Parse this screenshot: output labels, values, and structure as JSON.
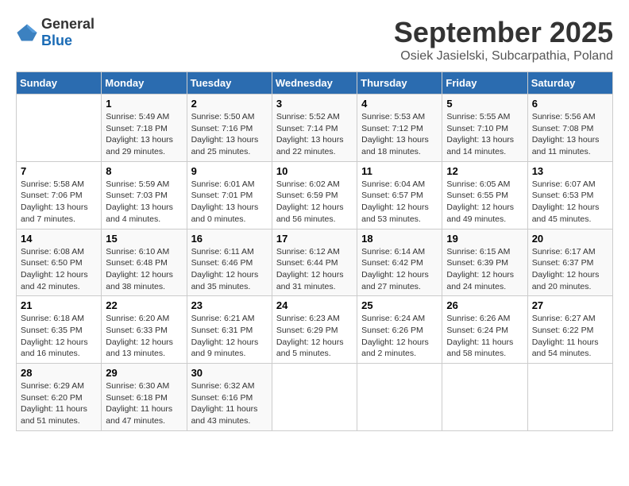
{
  "header": {
    "logo_general": "General",
    "logo_blue": "Blue",
    "month_title": "September 2025",
    "subtitle": "Osiek Jasielski, Subcarpathia, Poland"
  },
  "columns": [
    "Sunday",
    "Monday",
    "Tuesday",
    "Wednesday",
    "Thursday",
    "Friday",
    "Saturday"
  ],
  "weeks": [
    [
      {
        "day": "",
        "info": ""
      },
      {
        "day": "1",
        "info": "Sunrise: 5:49 AM\nSunset: 7:18 PM\nDaylight: 13 hours\nand 29 minutes."
      },
      {
        "day": "2",
        "info": "Sunrise: 5:50 AM\nSunset: 7:16 PM\nDaylight: 13 hours\nand 25 minutes."
      },
      {
        "day": "3",
        "info": "Sunrise: 5:52 AM\nSunset: 7:14 PM\nDaylight: 13 hours\nand 22 minutes."
      },
      {
        "day": "4",
        "info": "Sunrise: 5:53 AM\nSunset: 7:12 PM\nDaylight: 13 hours\nand 18 minutes."
      },
      {
        "day": "5",
        "info": "Sunrise: 5:55 AM\nSunset: 7:10 PM\nDaylight: 13 hours\nand 14 minutes."
      },
      {
        "day": "6",
        "info": "Sunrise: 5:56 AM\nSunset: 7:08 PM\nDaylight: 13 hours\nand 11 minutes."
      }
    ],
    [
      {
        "day": "7",
        "info": "Sunrise: 5:58 AM\nSunset: 7:06 PM\nDaylight: 13 hours\nand 7 minutes."
      },
      {
        "day": "8",
        "info": "Sunrise: 5:59 AM\nSunset: 7:03 PM\nDaylight: 13 hours\nand 4 minutes."
      },
      {
        "day": "9",
        "info": "Sunrise: 6:01 AM\nSunset: 7:01 PM\nDaylight: 13 hours\nand 0 minutes."
      },
      {
        "day": "10",
        "info": "Sunrise: 6:02 AM\nSunset: 6:59 PM\nDaylight: 12 hours\nand 56 minutes."
      },
      {
        "day": "11",
        "info": "Sunrise: 6:04 AM\nSunset: 6:57 PM\nDaylight: 12 hours\nand 53 minutes."
      },
      {
        "day": "12",
        "info": "Sunrise: 6:05 AM\nSunset: 6:55 PM\nDaylight: 12 hours\nand 49 minutes."
      },
      {
        "day": "13",
        "info": "Sunrise: 6:07 AM\nSunset: 6:53 PM\nDaylight: 12 hours\nand 45 minutes."
      }
    ],
    [
      {
        "day": "14",
        "info": "Sunrise: 6:08 AM\nSunset: 6:50 PM\nDaylight: 12 hours\nand 42 minutes."
      },
      {
        "day": "15",
        "info": "Sunrise: 6:10 AM\nSunset: 6:48 PM\nDaylight: 12 hours\nand 38 minutes."
      },
      {
        "day": "16",
        "info": "Sunrise: 6:11 AM\nSunset: 6:46 PM\nDaylight: 12 hours\nand 35 minutes."
      },
      {
        "day": "17",
        "info": "Sunrise: 6:12 AM\nSunset: 6:44 PM\nDaylight: 12 hours\nand 31 minutes."
      },
      {
        "day": "18",
        "info": "Sunrise: 6:14 AM\nSunset: 6:42 PM\nDaylight: 12 hours\nand 27 minutes."
      },
      {
        "day": "19",
        "info": "Sunrise: 6:15 AM\nSunset: 6:39 PM\nDaylight: 12 hours\nand 24 minutes."
      },
      {
        "day": "20",
        "info": "Sunrise: 6:17 AM\nSunset: 6:37 PM\nDaylight: 12 hours\nand 20 minutes."
      }
    ],
    [
      {
        "day": "21",
        "info": "Sunrise: 6:18 AM\nSunset: 6:35 PM\nDaylight: 12 hours\nand 16 minutes."
      },
      {
        "day": "22",
        "info": "Sunrise: 6:20 AM\nSunset: 6:33 PM\nDaylight: 12 hours\nand 13 minutes."
      },
      {
        "day": "23",
        "info": "Sunrise: 6:21 AM\nSunset: 6:31 PM\nDaylight: 12 hours\nand 9 minutes."
      },
      {
        "day": "24",
        "info": "Sunrise: 6:23 AM\nSunset: 6:29 PM\nDaylight: 12 hours\nand 5 minutes."
      },
      {
        "day": "25",
        "info": "Sunrise: 6:24 AM\nSunset: 6:26 PM\nDaylight: 12 hours\nand 2 minutes."
      },
      {
        "day": "26",
        "info": "Sunrise: 6:26 AM\nSunset: 6:24 PM\nDaylight: 11 hours\nand 58 minutes."
      },
      {
        "day": "27",
        "info": "Sunrise: 6:27 AM\nSunset: 6:22 PM\nDaylight: 11 hours\nand 54 minutes."
      }
    ],
    [
      {
        "day": "28",
        "info": "Sunrise: 6:29 AM\nSunset: 6:20 PM\nDaylight: 11 hours\nand 51 minutes."
      },
      {
        "day": "29",
        "info": "Sunrise: 6:30 AM\nSunset: 6:18 PM\nDaylight: 11 hours\nand 47 minutes."
      },
      {
        "day": "30",
        "info": "Sunrise: 6:32 AM\nSunset: 6:16 PM\nDaylight: 11 hours\nand 43 minutes."
      },
      {
        "day": "",
        "info": ""
      },
      {
        "day": "",
        "info": ""
      },
      {
        "day": "",
        "info": ""
      },
      {
        "day": "",
        "info": ""
      }
    ]
  ]
}
